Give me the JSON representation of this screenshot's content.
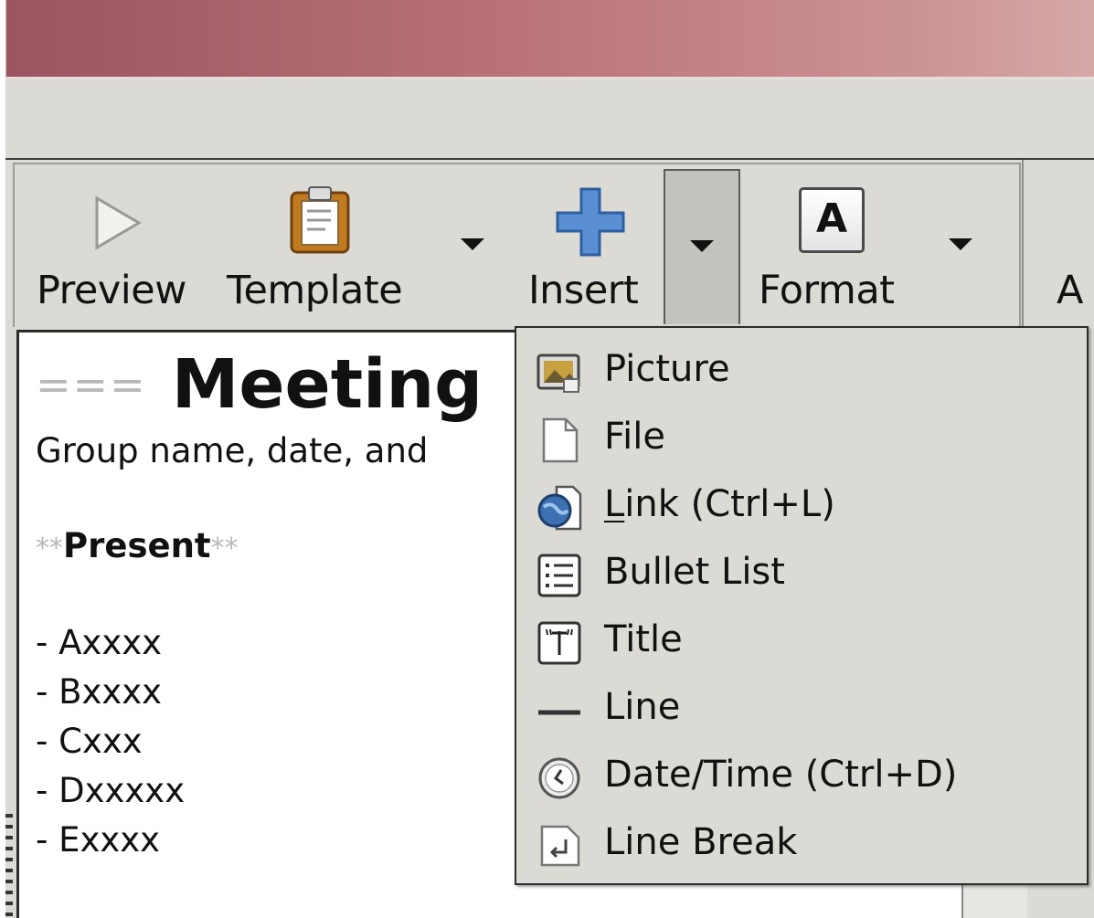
{
  "toolbar": {
    "preview_label": "Preview",
    "template_label": "Template",
    "insert_label": "Insert",
    "format_label": "Format",
    "partial_label": "A",
    "format_icon_letter": "A"
  },
  "document": {
    "heading_markup": "===",
    "heading_text": "Meeting",
    "subtitle": "Group name, date, and",
    "bold_markup_open": "**",
    "present_label": "Present",
    "bold_markup_close": "**",
    "attendees": [
      "- Axxxx",
      "- Bxxxx",
      "- Cxxx",
      "- Dxxxxx",
      "- Exxxx"
    ]
  },
  "insert_menu": {
    "items": [
      {
        "label": "Picture",
        "icon": "picture-icon"
      },
      {
        "label": "File",
        "icon": "file-icon"
      },
      {
        "label": "Link (Ctrl+L)",
        "mnemonic": "L",
        "rest": "ink (Ctrl+L)",
        "icon": "globe-link-icon"
      },
      {
        "label": "Bullet List",
        "icon": "bullet-list-icon"
      },
      {
        "label": "Title",
        "icon": "title-icon"
      },
      {
        "label": "Line",
        "icon": "line-icon"
      },
      {
        "label": "Date/Time (Ctrl+D)",
        "icon": "clock-icon"
      },
      {
        "label": "Line Break",
        "icon": "line-break-icon"
      }
    ]
  },
  "colors": {
    "titlebar_start": "#9a5560",
    "titlebar_end": "#d6a8a8",
    "chrome": "#dcdad5",
    "insert_icon_blue": "#5b8fd4",
    "template_icon_orange": "#c27a1f",
    "markup_gray": "#b8b8b8"
  }
}
